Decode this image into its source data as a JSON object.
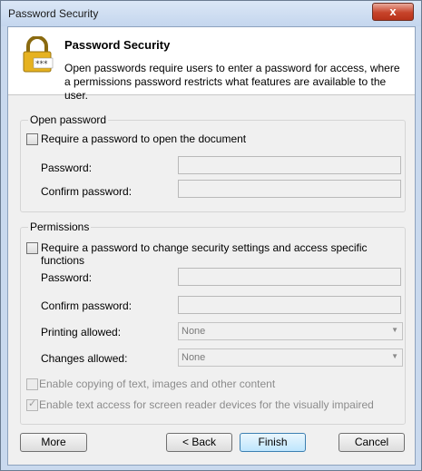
{
  "window": {
    "title": "Password Security",
    "close_label": "x"
  },
  "header": {
    "title": "Password Security",
    "description": "Open passwords require users to enter a password for access, where a permissions password restricts what features are available to the user."
  },
  "open_password": {
    "group_label": "Open password",
    "require_label": "Require a password to open the document",
    "require_checked": false,
    "password_label": "Password:",
    "password_value": "",
    "confirm_label": "Confirm password:",
    "confirm_value": ""
  },
  "permissions": {
    "group_label": "Permissions",
    "require_label": "Require a password to change security settings and access specific functions",
    "require_checked": false,
    "password_label": "Password:",
    "password_value": "",
    "confirm_label": "Confirm password:",
    "confirm_value": "",
    "printing_label": "Printing allowed:",
    "printing_value": "None",
    "changes_label": "Changes allowed:",
    "changes_value": "None",
    "copy_label": "Enable copying of text, images and other content",
    "copy_checked": false,
    "screen_reader_label": "Enable text access for screen reader devices for the visually impaired",
    "screen_reader_checked": true
  },
  "buttons": {
    "more": "More",
    "back": "< Back",
    "finish": "Finish",
    "cancel": "Cancel"
  },
  "icons": {
    "header_icon": "lock-icon",
    "close_icon": "close-icon"
  }
}
